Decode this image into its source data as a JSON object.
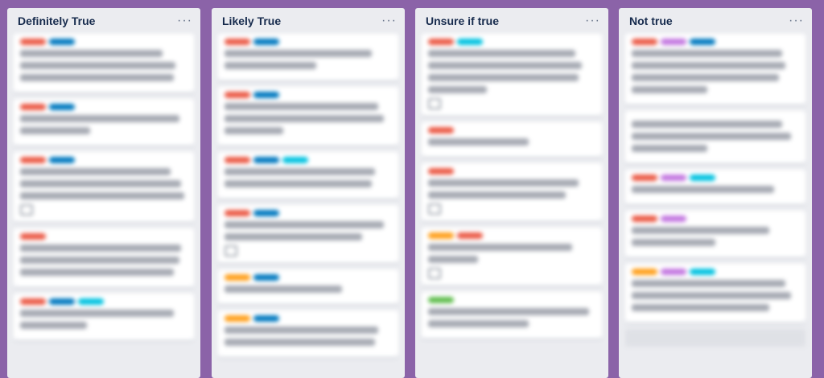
{
  "colors": {
    "board_bg": "#8b63a8",
    "list_bg": "#ebecf0",
    "label_red": "#eb5a46",
    "label_blue": "#0079bf",
    "label_sky": "#00c2e0",
    "label_orange": "#ff9f1a",
    "label_purple": "#c377e0",
    "label_green": "#61bd4f"
  },
  "lists": [
    {
      "title": "Definitely True",
      "menu": "···",
      "cards": [
        {
          "labels": [
            "red",
            "blue"
          ],
          "lines": [
            0.85,
            0.93,
            0.92
          ],
          "badge": false
        },
        {
          "labels": [
            "red",
            "blue"
          ],
          "lines": [
            0.95,
            0.42
          ],
          "badge": false
        },
        {
          "labels": [
            "red",
            "blue"
          ],
          "lines": [
            0.9,
            0.96,
            0.98
          ],
          "badge": true
        },
        {
          "labels": [
            "red"
          ],
          "lines": [
            0.96,
            0.95,
            0.92
          ],
          "badge": false
        },
        {
          "labels": [
            "red",
            "blue",
            "sky"
          ],
          "lines": [
            0.92,
            0.4
          ],
          "badge": false
        }
      ]
    },
    {
      "title": "Likely True",
      "menu": "···",
      "cards": [
        {
          "labels": [
            "red",
            "blue"
          ],
          "lines": [
            0.88,
            0.55
          ],
          "badge": false
        },
        {
          "labels": [
            "red",
            "blue"
          ],
          "lines": [
            0.92,
            0.95,
            0.35
          ],
          "badge": false
        },
        {
          "labels": [
            "red",
            "blue",
            "sky"
          ],
          "lines": [
            0.9,
            0.88
          ],
          "badge": false
        },
        {
          "labels": [
            "red",
            "blue"
          ],
          "lines": [
            0.95,
            0.82
          ],
          "badge": true
        },
        {
          "labels": [
            "orange",
            "blue"
          ],
          "lines": [
            0.7
          ],
          "badge": false
        },
        {
          "labels": [
            "orange",
            "blue"
          ],
          "lines": [
            0.92,
            0.9
          ],
          "badge": false
        }
      ]
    },
    {
      "title": "Unsure if true",
      "menu": "···",
      "cards": [
        {
          "labels": [
            "red",
            "sky"
          ],
          "lines": [
            0.88,
            0.92,
            0.9,
            0.35
          ],
          "badge": true
        },
        {
          "labels": [
            "red"
          ],
          "lines": [
            0.6
          ],
          "badge": false
        },
        {
          "labels": [
            "red"
          ],
          "lines": [
            0.9,
            0.82
          ],
          "badge": true
        },
        {
          "labels": [
            "orange",
            "red"
          ],
          "lines": [
            0.86,
            0.3
          ],
          "badge": true
        },
        {
          "labels": [
            "green"
          ],
          "lines": [
            0.96,
            0.6
          ],
          "badge": false
        }
      ]
    },
    {
      "title": "Not true",
      "menu": "···",
      "cards": [
        {
          "labels": [
            "red",
            "purple",
            "blue"
          ],
          "lines": [
            0.9,
            0.92,
            0.88,
            0.45
          ],
          "badge": false
        },
        {
          "labels": [],
          "lines": [
            0.9,
            0.95,
            0.45
          ],
          "badge": false
        },
        {
          "labels": [
            "red",
            "purple",
            "sky"
          ],
          "lines": [
            0.85
          ],
          "badge": false
        },
        {
          "labels": [
            "red",
            "purple"
          ],
          "lines": [
            0.82,
            0.5
          ],
          "badge": false
        },
        {
          "labels": [
            "orange",
            "purple",
            "sky"
          ],
          "lines": [
            0.92,
            0.95,
            0.82
          ],
          "badge": false
        }
      ],
      "has_add_card": true
    }
  ]
}
